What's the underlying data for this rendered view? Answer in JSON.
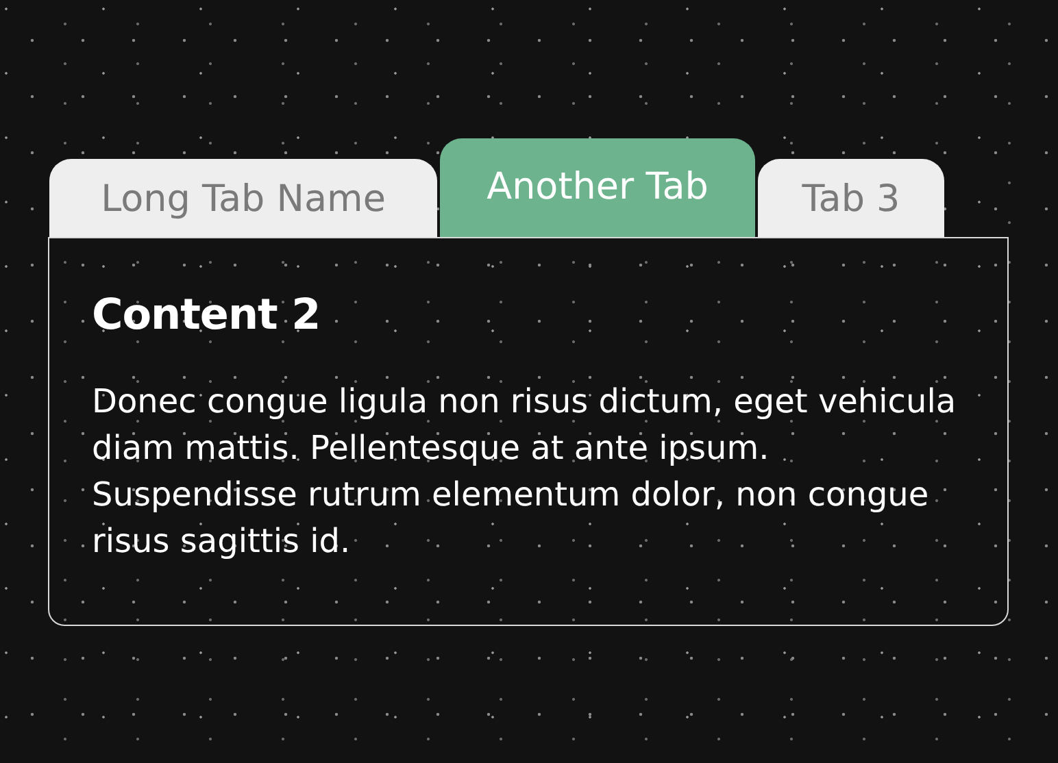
{
  "tabs": [
    {
      "label": "Long Tab Name",
      "selected": false
    },
    {
      "label": "Another Tab",
      "selected": true
    },
    {
      "label": "Tab 3",
      "selected": false
    }
  ],
  "panel": {
    "heading": "Content 2",
    "text": "Donec congue ligula non risus dictum, eget vehicula diam mattis. Pellentesque at ante ipsum. Suspendisse rutrum elementum dolor, non congue risus sagittis id."
  }
}
